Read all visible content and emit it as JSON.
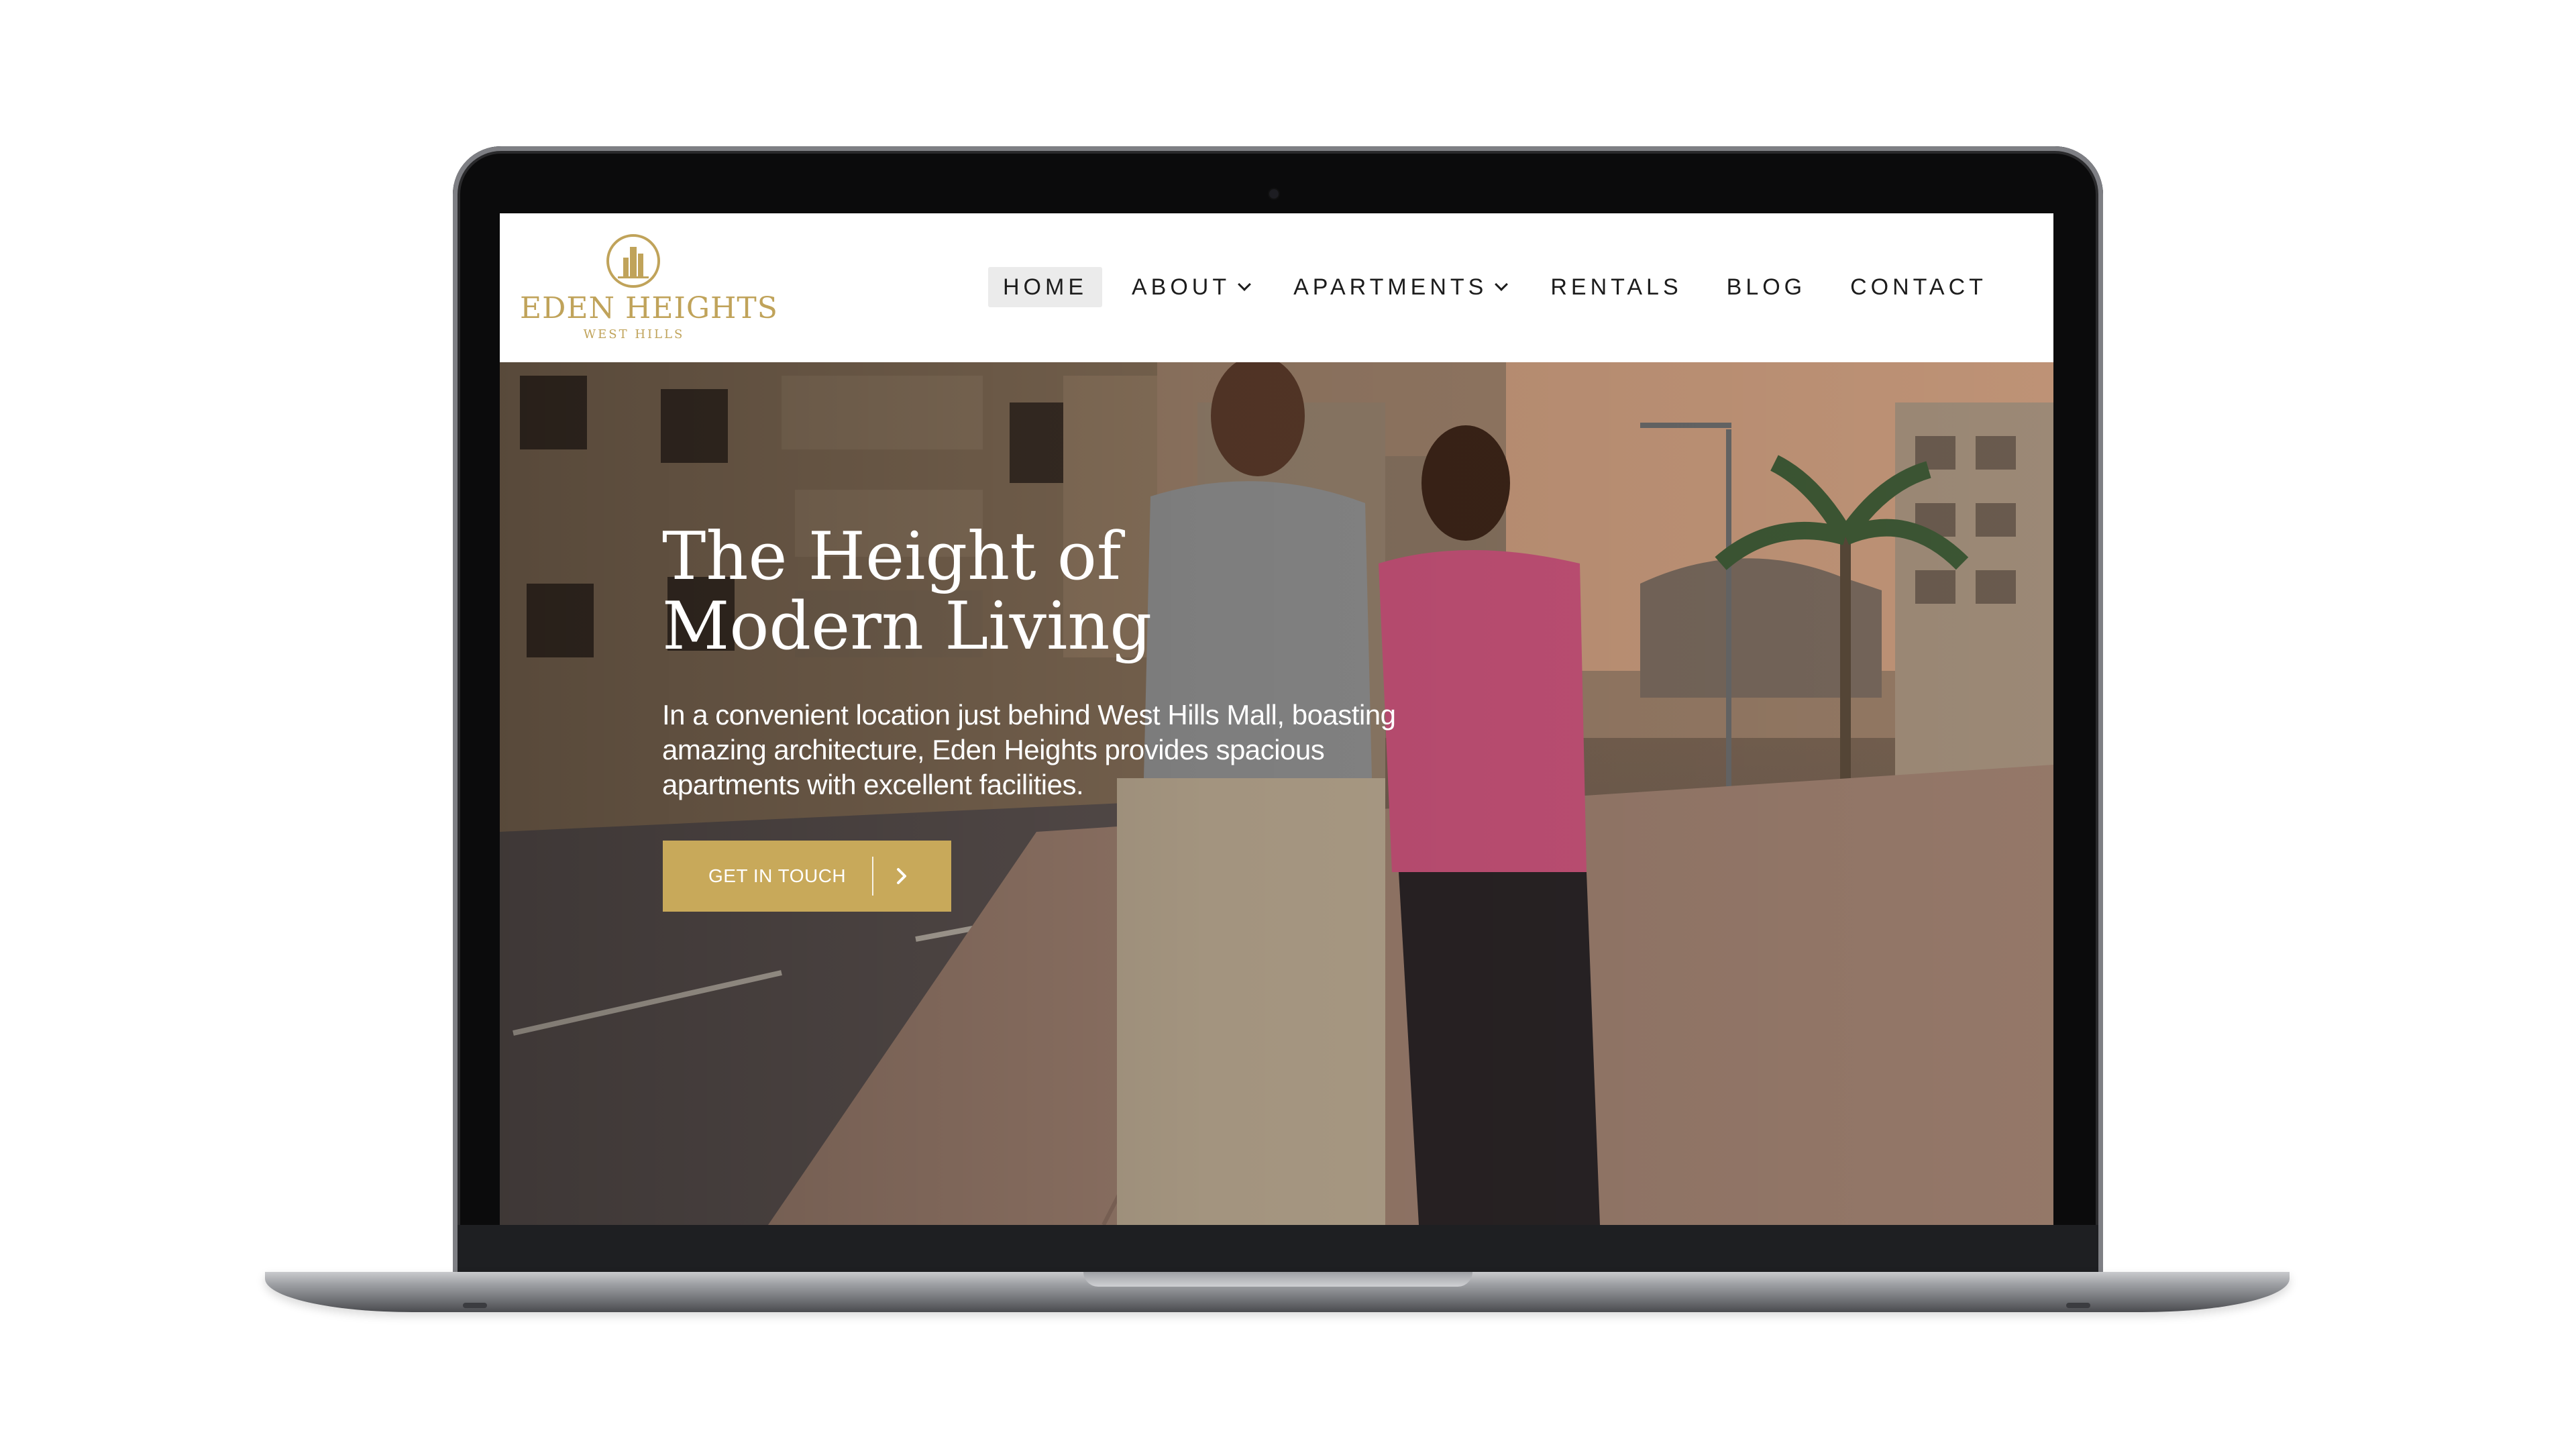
{
  "brand": {
    "name": "EDEN HEIGHTS",
    "sub": "WEST HILLS",
    "logo_icon": "building-emblem-icon",
    "accent_color": "#c8a95a"
  },
  "nav": {
    "home": "HOME",
    "about": "ABOUT",
    "apartments": "APARTMENTS",
    "rentals": "RENTALS",
    "blog": "BLOG",
    "contact": "CONTACT",
    "active": "HOME",
    "dropdown_icon": "chevron-down-icon"
  },
  "hero": {
    "title": "The Height of Modern Living",
    "text": "In a convenient location just behind West Hills Mall, boasting amazing architecture, Eden Heights provides spacious apartments with excellent facilities.",
    "cta_label": "GET IN TOUCH",
    "cta_icon": "chevron-right-icon",
    "image_alt": "couple-walking-photo"
  }
}
